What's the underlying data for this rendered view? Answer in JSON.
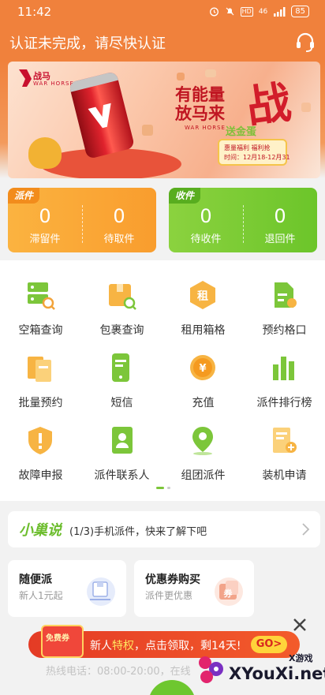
{
  "status_bar": {
    "time": "11:42",
    "battery": "85",
    "hd": "HD",
    "signal": "46"
  },
  "header": {
    "title": "认证未完成，请尽快认证",
    "support_icon": "headset-icon"
  },
  "banner": {
    "brand": "战马",
    "brand_en": "WAR HORSE",
    "slogan_line1": "有能量",
    "slogan_line2": "放马来",
    "slogan_char": "战",
    "badge_title": "送金蛋",
    "badge_line1": "惠量福利 福利抢",
    "badge_line2": "时间：12月18-12月31"
  },
  "dispatch_card": {
    "tag": "派件",
    "stats": [
      {
        "value": "0",
        "label": "滞留件"
      },
      {
        "value": "0",
        "label": "待取件"
      }
    ]
  },
  "receive_card": {
    "tag": "收件",
    "stats": [
      {
        "value": "0",
        "label": "待收件"
      },
      {
        "value": "0",
        "label": "退回件"
      }
    ]
  },
  "grid": [
    {
      "label": "空箱查询",
      "icon": "empty-box-search-icon"
    },
    {
      "label": "包裹查询",
      "icon": "package-search-icon"
    },
    {
      "label": "租用箱格",
      "icon": "rent-hexagon-icon",
      "icon_text": "租"
    },
    {
      "label": "预约格口",
      "icon": "reserve-slot-icon"
    },
    {
      "label": "批量预约",
      "icon": "batch-reserve-icon"
    },
    {
      "label": "短信",
      "icon": "sms-icon"
    },
    {
      "label": "充值",
      "icon": "coin-recharge-icon",
      "icon_text": "¥"
    },
    {
      "label": "派件排行榜",
      "icon": "ranking-bars-icon"
    },
    {
      "label": "故障申报",
      "icon": "fault-shield-icon"
    },
    {
      "label": "派件联系人",
      "icon": "contacts-book-icon"
    },
    {
      "label": "组团派件",
      "icon": "group-location-icon"
    },
    {
      "label": "装机申请",
      "icon": "install-apply-icon"
    }
  ],
  "notice": {
    "brand": "小巢说",
    "text": "(1/3)手机派件，快来了解下吧"
  },
  "promos": [
    {
      "title": "随便派",
      "subtitle": "新人1元起",
      "icon": "cart-box-icon"
    },
    {
      "title": "优惠券购买",
      "subtitle": "派件更优惠",
      "icon": "coupon-icon",
      "icon_text": "券"
    }
  ],
  "ad": {
    "gift_label": "免费券",
    "text_a": "新人",
    "text_highlight": "特权",
    "text_b": "，点击领取，剩14天!",
    "go": "GO>"
  },
  "hotline": "热线电话：08:00-20:00，在线",
  "watermark": {
    "site": "XYouXi.net",
    "zh": "X游戏"
  },
  "colors": {
    "orange": "#f0813c",
    "green": "#6ec72f",
    "red": "#e43b25"
  }
}
